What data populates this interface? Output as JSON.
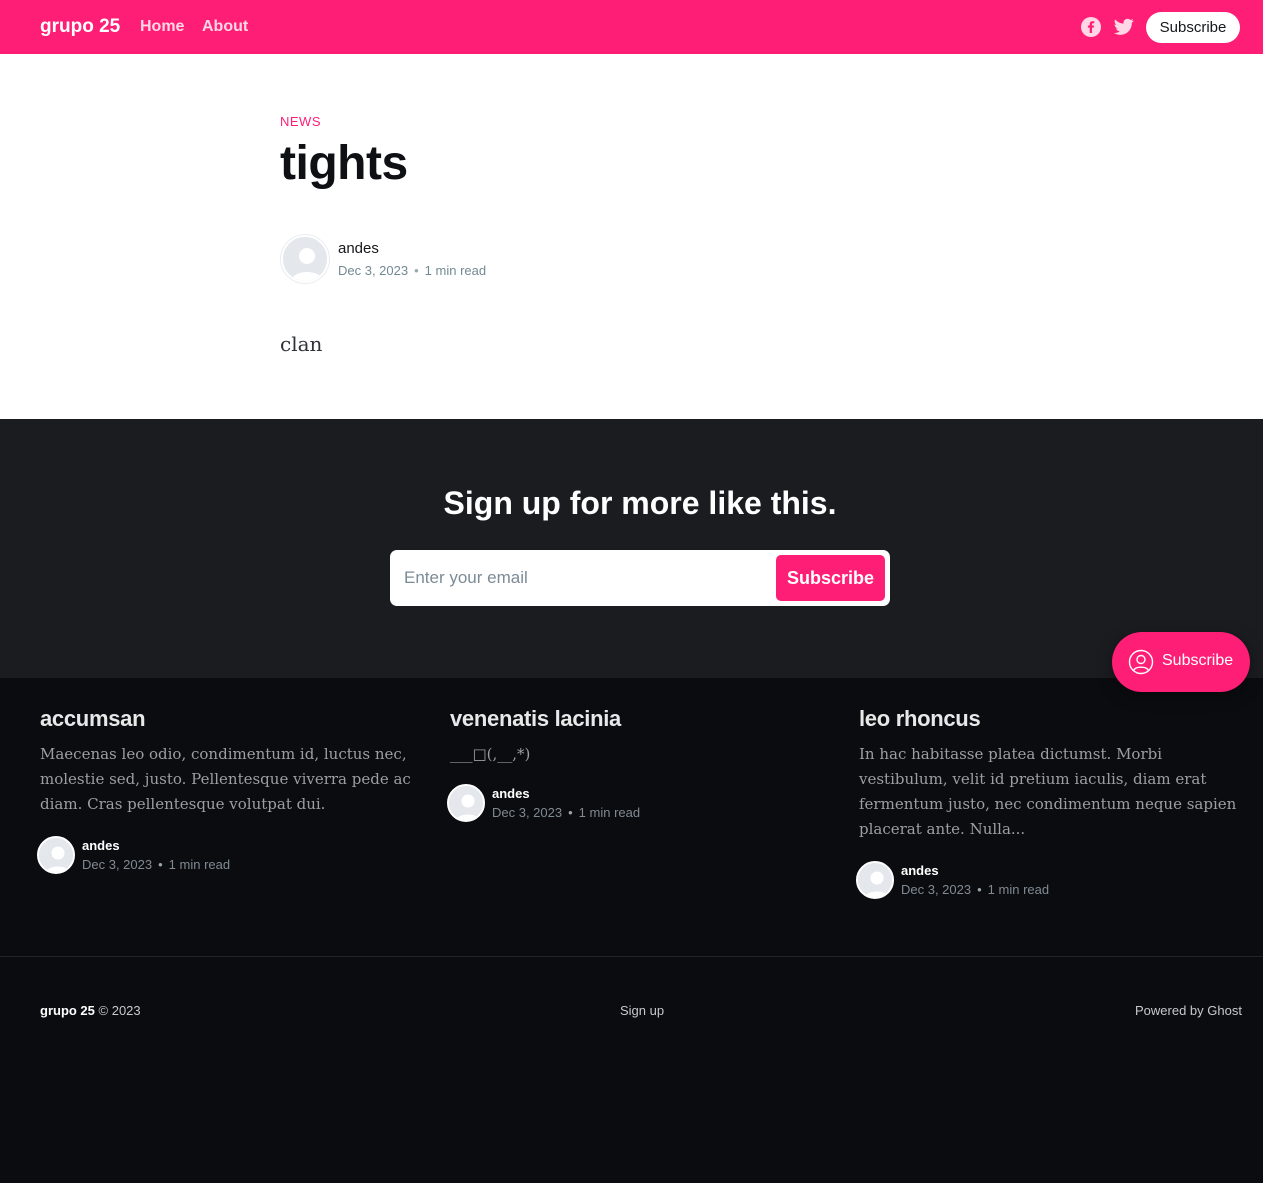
{
  "header": {
    "site_title": "grupo 25",
    "nav": [
      "Home",
      "About"
    ],
    "social_icons": [
      "facebook-icon",
      "twitter-icon"
    ],
    "subscribe_label": "Subscribe",
    "bg_color": "#fe1e75"
  },
  "article": {
    "tag": "NEWS",
    "title": "tights",
    "author": "andes",
    "date": "Dec 3, 2023",
    "read_time": "1 min read",
    "body": "clan"
  },
  "signup": {
    "heading": "Sign up for more like this.",
    "email_placeholder": "Enter your email",
    "button_label": "Subscribe"
  },
  "floating_button": {
    "label": "Subscribe",
    "icon": "user-circle-icon"
  },
  "related_posts": [
    {
      "title": "accumsan",
      "excerpt": "Maecenas leo odio, condimentum id, luctus nec, molestie sed, justo. Pellentesque viverra pede ac diam. Cras pellentesque volutpat dui.",
      "author": "andes",
      "date": "Dec 3, 2023",
      "read_time": "1 min read"
    },
    {
      "title": "venenatis lacinia",
      "excerpt": "___□(,__,*)",
      "author": "andes",
      "date": "Dec 3, 2023",
      "read_time": "1 min read"
    },
    {
      "title": "leo rhoncus",
      "excerpt": "In hac habitasse platea dictumst. Morbi vestibulum, velit id pretium iaculis, diam erat fermentum justo, nec condimentum neque sapien placerat ante. Nulla...",
      "author": "andes",
      "date": "Dec 3, 2023",
      "read_time": "1 min read"
    }
  ],
  "footer": {
    "site_title": "grupo 25",
    "copyright": "© 2023",
    "signup_link": "Sign up",
    "powered_by": "Powered by Ghost"
  },
  "colors": {
    "accent": "#fe1e75",
    "dark_band": "#1b1c20",
    "footer_bg": "#0b0c0f"
  }
}
